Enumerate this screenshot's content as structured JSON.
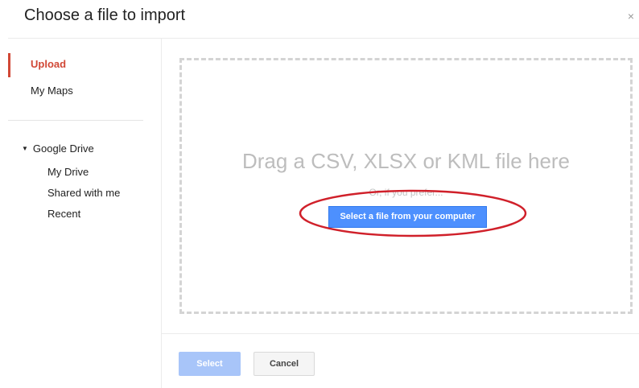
{
  "dialog": {
    "title": "Choose a file to import",
    "close_glyph": "×"
  },
  "sidebar": {
    "upload": "Upload",
    "my_maps": "My Maps",
    "drive": {
      "toggle_glyph": "▼",
      "label": "Google Drive",
      "items": [
        "My Drive",
        "Shared with me",
        "Recent"
      ]
    }
  },
  "dropzone": {
    "drag_text": "Drag a CSV, XLSX or KML file here",
    "or_text": "Or, if you prefer...",
    "select_file_label": "Select a file from your computer"
  },
  "footer": {
    "select_label": "Select",
    "cancel_label": "Cancel"
  },
  "colors": {
    "accent_red": "#d14836",
    "primary_blue": "#4d90fe",
    "disabled_blue": "#a8c5f9",
    "annotation_red": "#d0202a"
  },
  "icons": {
    "close": "close-icon",
    "expand": "triangle-down-icon"
  }
}
